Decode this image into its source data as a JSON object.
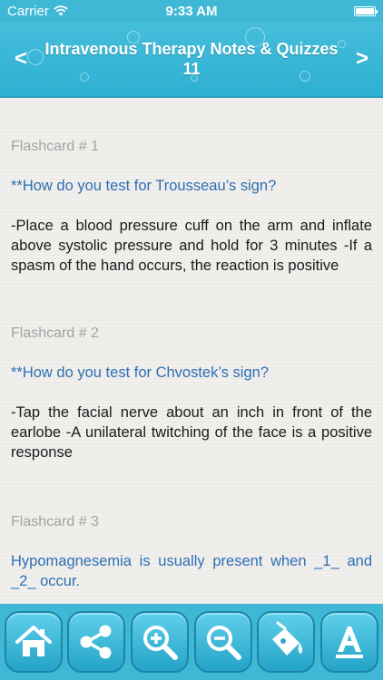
{
  "status_bar": {
    "carrier": "Carrier",
    "time": "9:33 AM",
    "battery_level": 1.0
  },
  "header": {
    "title": "Intravenous Therapy Notes & Quizzes 11",
    "prev_icon": "chevron-left-icon",
    "next_icon": "chevron-right-icon",
    "prev_glyph": "<",
    "next_glyph": ">"
  },
  "flashcards": [
    {
      "label": "Flashcard # 1",
      "question": "**How do you test for Trousseau’s sign?",
      "answer": "-Place a blood pressure cuff on the arm and inflate above systolic pressure and hold for 3 minutes -If a spasm of the hand occurs, the reaction is positive"
    },
    {
      "label": "Flashcard # 2",
      "question": "**How do you test for Chvostek’s sign?",
      "answer": "-Tap the facial nerve about an inch in front of the earlobe -A unilateral twitching of the face is a positive response"
    },
    {
      "label": "Flashcard # 3",
      "question": "Hypomagnesemia is usually present when _1_ and _2_ occur.",
      "answer": ""
    }
  ],
  "toolbar": {
    "buttons": [
      "home-icon",
      "share-icon",
      "zoom-in-icon",
      "zoom-out-icon",
      "paint-bucket-icon",
      "font-icon"
    ]
  },
  "colors": {
    "accent": "#3fb8d6",
    "question": "#2c6fb3",
    "label": "#a3a3a3",
    "background": "#f1efec"
  }
}
